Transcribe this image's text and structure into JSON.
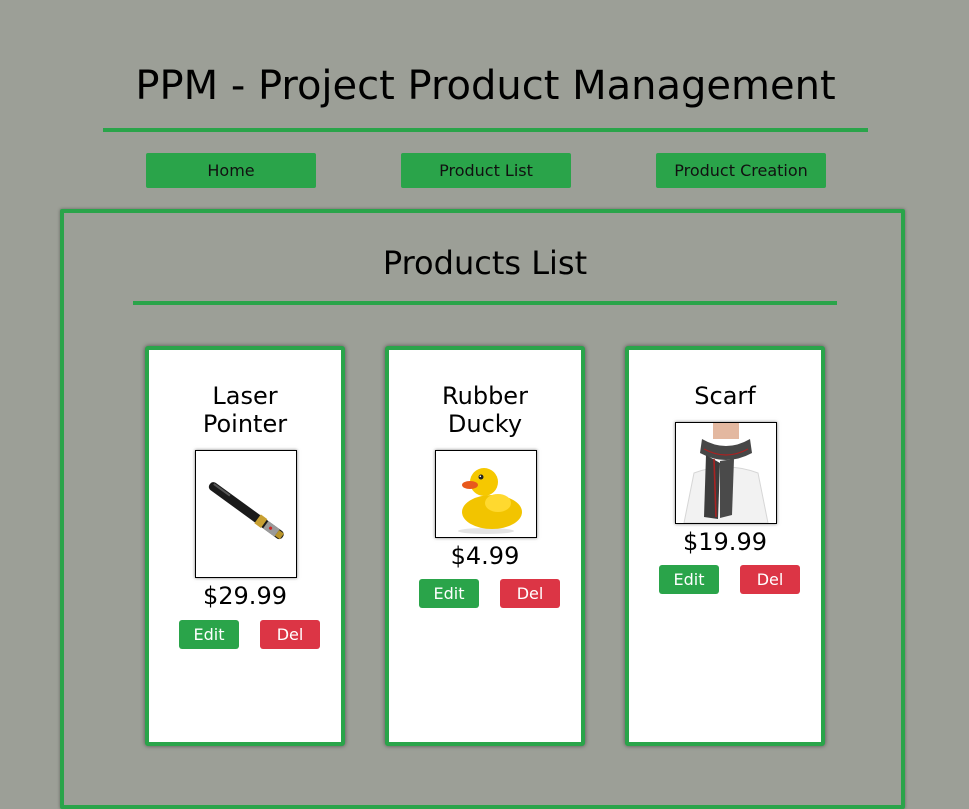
{
  "header": {
    "title": "PPM - Project Product Management"
  },
  "nav": [
    {
      "label": "Home"
    },
    {
      "label": "Product List"
    },
    {
      "label": "Product Creation"
    }
  ],
  "main": {
    "title": "Products List",
    "products": [
      {
        "name_line1": "Laser",
        "name_line2": "Pointer",
        "price": "$29.99",
        "image": "laser-pointer-image",
        "edit_label": "Edit",
        "del_label": "Del"
      },
      {
        "name_line1": "Rubber",
        "name_line2": "Ducky",
        "price": "$4.99",
        "image": "rubber-duck-image",
        "edit_label": "Edit",
        "del_label": "Del"
      },
      {
        "name_line1": "Scarf",
        "name_line2": "",
        "price": "$19.99",
        "image": "scarf-image",
        "edit_label": "Edit",
        "del_label": "Del"
      }
    ]
  },
  "colors": {
    "background": "#9c9f97",
    "accent_green": "#2aa44a",
    "delete_red": "#dc3545"
  }
}
